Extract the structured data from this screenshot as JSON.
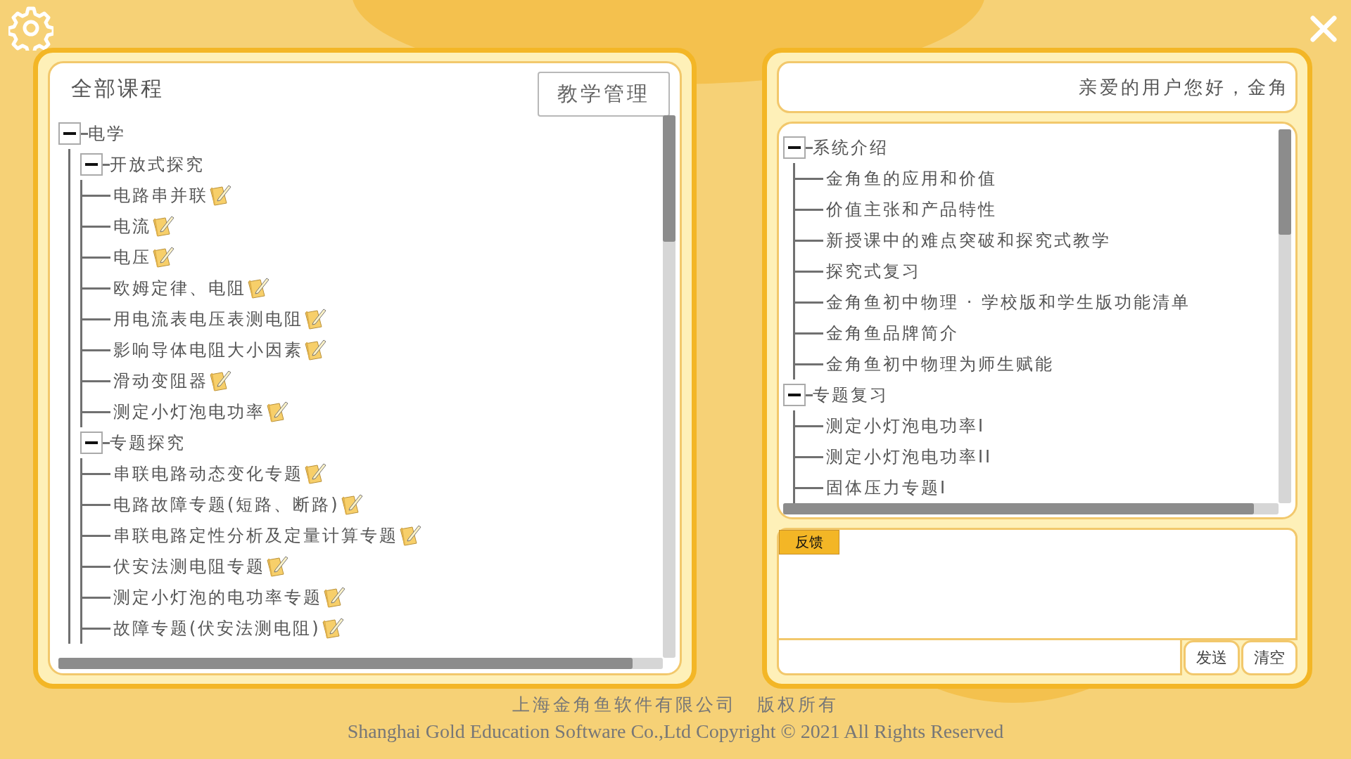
{
  "left_panel": {
    "title": "全部课程",
    "manage_button": "教学管理",
    "tree": [
      {
        "label": "电学",
        "kind": "group",
        "expanded": true,
        "children": [
          {
            "label": "开放式探究",
            "kind": "group",
            "expanded": true,
            "children": [
              {
                "label": "电路串并联",
                "kind": "lesson"
              },
              {
                "label": "电流",
                "kind": "lesson"
              },
              {
                "label": "电压",
                "kind": "lesson"
              },
              {
                "label": "欧姆定律、电阻",
                "kind": "lesson"
              },
              {
                "label": "用电流表电压表测电阻",
                "kind": "lesson"
              },
              {
                "label": "影响导体电阻大小因素",
                "kind": "lesson"
              },
              {
                "label": "滑动变阻器",
                "kind": "lesson"
              },
              {
                "label": "测定小灯泡电功率",
                "kind": "lesson"
              }
            ]
          },
          {
            "label": "专题探究",
            "kind": "group",
            "expanded": true,
            "children": [
              {
                "label": "串联电路动态变化专题",
                "kind": "lesson"
              },
              {
                "label": "电路故障专题(短路、断路)",
                "kind": "lesson"
              },
              {
                "label": "串联电路定性分析及定量计算专题",
                "kind": "lesson"
              },
              {
                "label": "伏安法测电阻专题",
                "kind": "lesson"
              },
              {
                "label": "测定小灯泡的电功率专题",
                "kind": "lesson"
              },
              {
                "label": "故障专题(伏安法测电阻)",
                "kind": "lesson"
              }
            ]
          }
        ]
      }
    ]
  },
  "right_panel": {
    "greeting": "亲爱的用户您好，金角",
    "tree": [
      {
        "label": "系统介绍",
        "kind": "group",
        "expanded": true,
        "children": [
          {
            "label": "金角鱼的应用和价值"
          },
          {
            "label": "价值主张和产品特性"
          },
          {
            "label": "新授课中的难点突破和探究式教学"
          },
          {
            "label": "探究式复习"
          },
          {
            "label": "金角鱼初中物理 · 学校版和学生版功能清单"
          },
          {
            "label": "金角鱼品牌简介"
          },
          {
            "label": "金角鱼初中物理为师生赋能"
          }
        ]
      },
      {
        "label": "专题复习",
        "kind": "group",
        "expanded": true,
        "children": [
          {
            "label": "测定小灯泡电功率I"
          },
          {
            "label": "测定小灯泡电功率II"
          },
          {
            "label": "固体压力专题I"
          }
        ]
      }
    ],
    "feedback": {
      "tab": "反馈",
      "send_button": "发送",
      "clear_button": "清空"
    }
  },
  "footer": {
    "company_cn": "上海金角鱼软件有限公司　版权所有",
    "copyright_en": "Shanghai Gold Education Software Co.,Ltd Copyright © 2021 All Rights Reserved"
  }
}
